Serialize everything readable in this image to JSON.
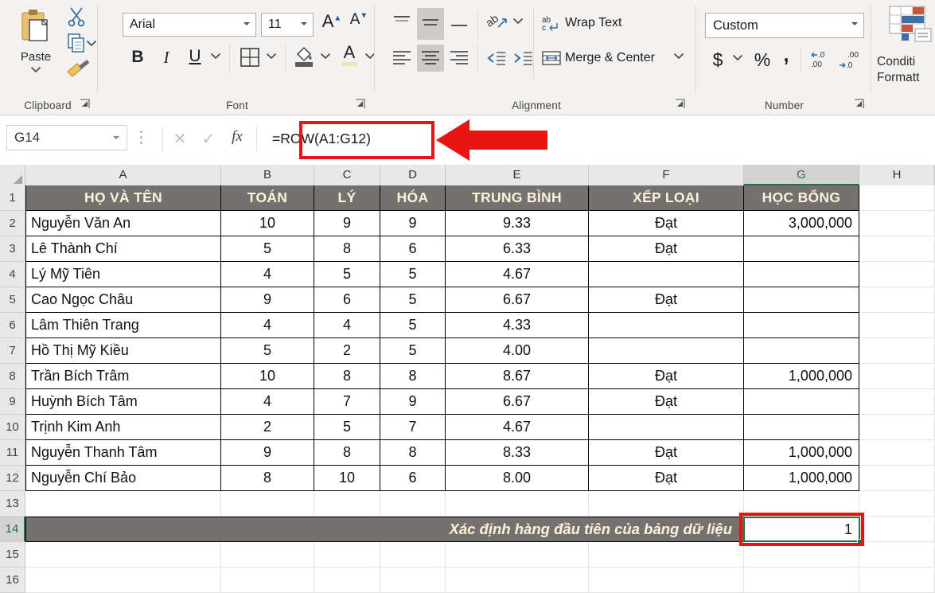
{
  "ribbon": {
    "groups": [
      {
        "name": "Clipboard",
        "label": "Clipboard"
      },
      {
        "name": "Font",
        "label": "Font"
      },
      {
        "name": "Alignment",
        "label": "Alignment"
      },
      {
        "name": "Number",
        "label": "Number"
      }
    ],
    "clipboard": {
      "paste_label": "Paste",
      "cut_icon": "scissors-icon",
      "copy_icon": "copy-icon",
      "format_painter_icon": "format-painter-icon"
    },
    "font": {
      "font_name": "Arial",
      "font_size": "11",
      "grow_font": "A",
      "shrink_font": "A",
      "bold": "B",
      "italic": "I",
      "underline": "U",
      "borders_icon": "borders-icon",
      "fill_color_icon": "fill-color-icon",
      "font_color": "A"
    },
    "alignment": {
      "wrap_text": "Wrap Text",
      "merge_center": "Merge & Center",
      "orientation_icon": "text-orientation-icon",
      "decrease_indent_icon": "decrease-indent-icon",
      "increase_indent_icon": "increase-indent-icon"
    },
    "number": {
      "format": "Custom",
      "accounting": "$",
      "percent": "%",
      "comma": ",",
      "increase_decimal": "increase-decimal-icon",
      "decrease_decimal": "decrease-decimal-icon"
    },
    "styles": {
      "conditional_formatting_line1": "Conditi",
      "conditional_formatting_line2": "Formatt"
    }
  },
  "formula_bar": {
    "name_box": "G14",
    "cancel_icon": "cancel-icon",
    "accept_icon": "accept-icon",
    "insert_function_icon": "fx",
    "formula": "=ROW(A1:G12)"
  },
  "grid": {
    "columns": [
      "A",
      "B",
      "C",
      "D",
      "E",
      "F",
      "G",
      "H"
    ],
    "selected_column": "G",
    "rows": [
      "1",
      "2",
      "3",
      "4",
      "5",
      "6",
      "7",
      "8",
      "9",
      "10",
      "11",
      "12",
      "13",
      "14",
      "15",
      "16"
    ],
    "selected_row": "14",
    "headers": [
      "HỌ VÀ TÊN",
      "TOÁN",
      "LÝ",
      "HÓA",
      "TRUNG BÌNH",
      "XẾP LOẠI",
      "HỌC BỔNG"
    ],
    "data": [
      [
        "Nguyễn Văn An",
        "10",
        "9",
        "9",
        "9.33",
        "Đạt",
        "3,000,000"
      ],
      [
        "Lê Thành Chí",
        "5",
        "8",
        "6",
        "6.33",
        "Đạt",
        ""
      ],
      [
        "Lý Mỹ Tiên",
        "4",
        "5",
        "5",
        "4.67",
        "",
        ""
      ],
      [
        "Cao Ngọc Châu",
        "9",
        "6",
        "5",
        "6.67",
        "Đạt",
        ""
      ],
      [
        "Lâm Thiên Trang",
        "4",
        "4",
        "5",
        "4.33",
        "",
        ""
      ],
      [
        "Hồ Thị Mỹ Kiều",
        "5",
        "2",
        "5",
        "4.00",
        "",
        ""
      ],
      [
        "Trần Bích Trâm",
        "10",
        "8",
        "8",
        "8.67",
        "Đạt",
        "1,000,000"
      ],
      [
        "Huỳnh Bích Tâm",
        "4",
        "7",
        "9",
        "6.67",
        "Đạt",
        ""
      ],
      [
        "Trịnh Kim Anh",
        "2",
        "5",
        "7",
        "4.67",
        "",
        ""
      ],
      [
        "Nguyễn Thanh Tâm",
        "9",
        "8",
        "8",
        "8.33",
        "Đạt",
        "1,000,000"
      ],
      [
        "Nguyễn Chí Bảo",
        "8",
        "10",
        "6",
        "8.00",
        "Đạt",
        "1,000,000"
      ]
    ],
    "footer_label": "Xác định hàng đầu tiên của bảng dữ liệu",
    "active_cell_value": "1"
  },
  "annotations": {
    "callout_color": "#e81313",
    "arrow_icon": "left-arrow-annotation"
  },
  "colors": {
    "header_fill": "#767171",
    "header_text": "#fdf3d8",
    "selection_green": "#217346",
    "annotation_red": "#e81313"
  }
}
